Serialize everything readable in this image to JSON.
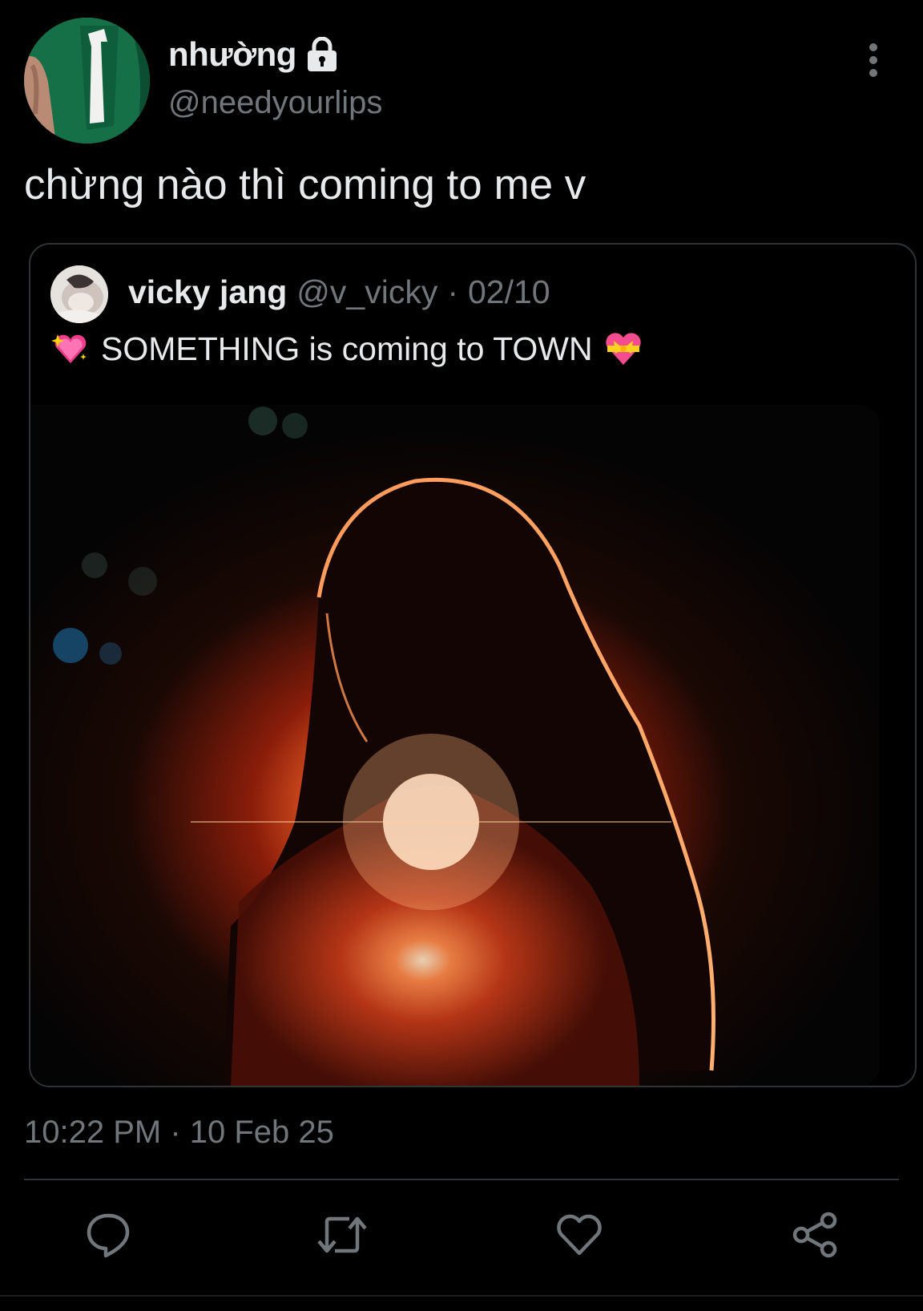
{
  "author": {
    "display_name": "nhường",
    "handle": "@needyourlips",
    "avatar_icon": "avatar-green-jersey",
    "locked_icon": "lock-icon"
  },
  "tweet": {
    "text": "chừng nào thì coming to me v",
    "timestamp": "10:22 PM · 10 Feb 25"
  },
  "quoted": {
    "display_name": "vicky jang",
    "handle": "@v_vicky",
    "separator": "·",
    "date": "02/10",
    "text": "SOMETHING is coming to TOWN",
    "emoji_before": "sparkling-heart-emoji",
    "emoji_after": "heart-with-ribbon-emoji",
    "media_icon": "backlit-silhouette-photo"
  },
  "actions": [
    {
      "name": "reply",
      "icon": "reply-icon"
    },
    {
      "name": "retweet",
      "icon": "retweet-icon"
    },
    {
      "name": "like",
      "icon": "heart-icon"
    },
    {
      "name": "share",
      "icon": "share-icon"
    }
  ],
  "colors": {
    "background": "#000000",
    "text": "#e7e9ea",
    "muted": "#71767b",
    "border": "#2f3336"
  }
}
